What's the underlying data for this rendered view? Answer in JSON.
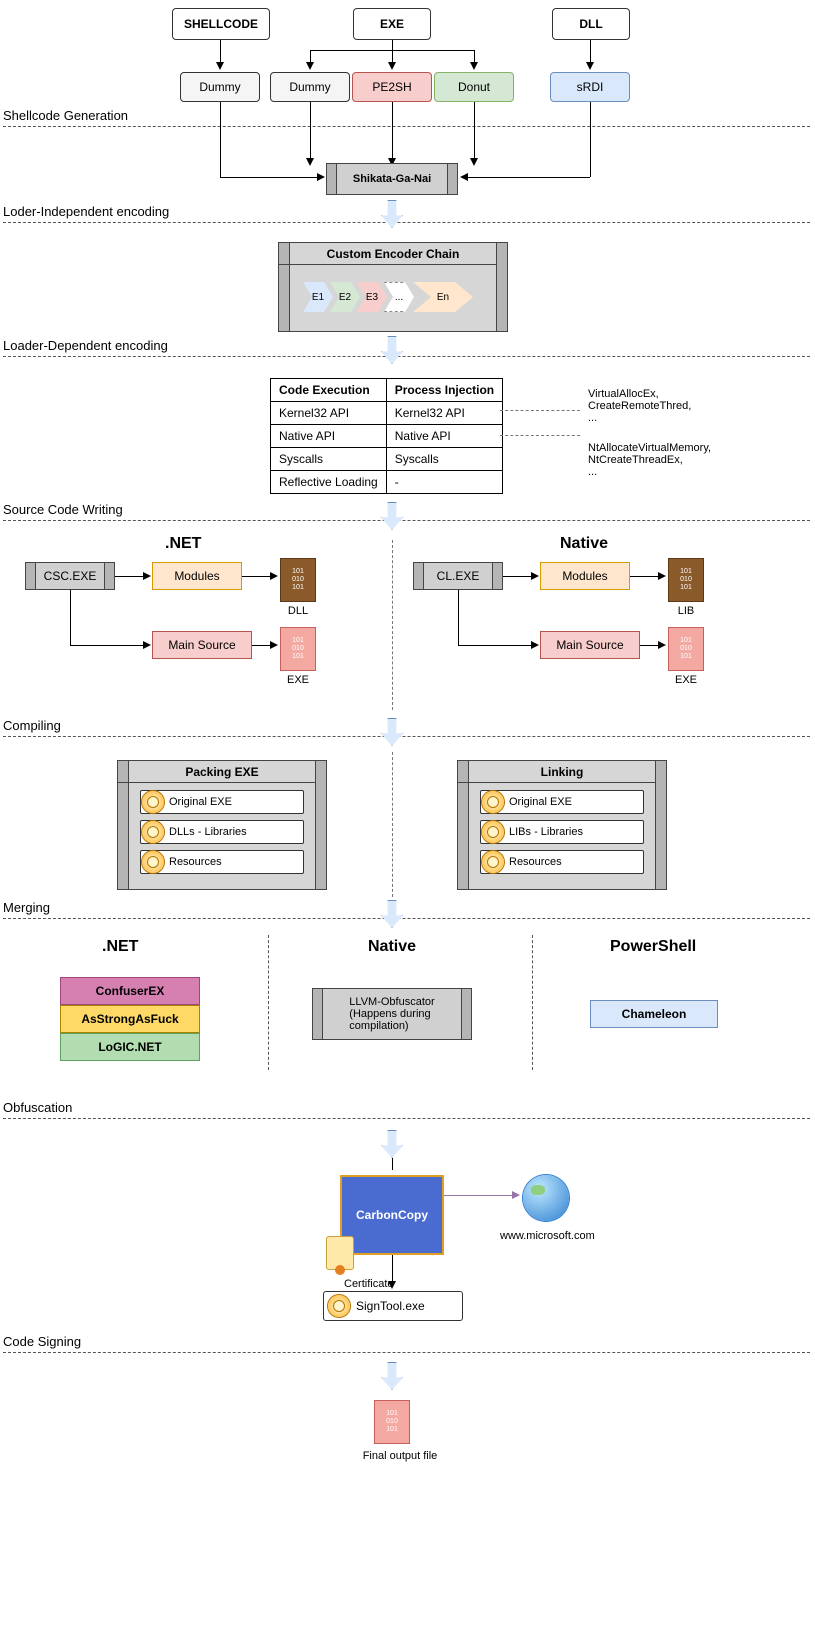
{
  "inputs": {
    "shellcode": "SHELLCODE",
    "exe": "EXE",
    "dll": "DLL"
  },
  "exe_options": {
    "dummy1": "Dummy",
    "dummy2": "Dummy",
    "pe2sh": "PE2SH",
    "donut": "Donut",
    "srdi": "sRDI"
  },
  "sections": {
    "shellcode_gen": "Shellcode Generation",
    "loder_indep": "Loder-Independent encoding",
    "loader_dep": "Loader-Dependent encoding",
    "source_writing": "Source Code Writing",
    "compiling": "Compiling",
    "merging": "Merging",
    "obfuscation": "Obfuscation",
    "code_signing": "Code Signing"
  },
  "shikata": "Shikata-Ga-Nai",
  "encoder_chain": {
    "title": "Custom Encoder Chain",
    "items": [
      "E1",
      "E2",
      "E3",
      "...",
      "En"
    ]
  },
  "tbl": {
    "h1": "Code Execution",
    "h2": "Process Injection",
    "rows": [
      [
        "Kernel32 API",
        "Kernel32 API"
      ],
      [
        "Native API",
        "Native API"
      ],
      [
        "Syscalls",
        "Syscalls"
      ],
      [
        "Reflective Loading",
        "-"
      ]
    ],
    "annot1": "VirtualAllocEx,\nCreateRemoteThred,\n...",
    "annot2": "NtAllocateVirtualMemory,\nNtCreateThreadEx,\n..."
  },
  "compile": {
    "net_title": ".NET",
    "native_title": "Native",
    "csc": "CSC.EXE",
    "cl": "CL.EXE",
    "modules": "Modules",
    "main": "Main Source",
    "dll": "DLL",
    "lib": "LIB",
    "exe": "EXE"
  },
  "packing": {
    "title": "Packing EXE",
    "items": [
      "Original EXE",
      "DLLs - Libraries",
      "Resources"
    ]
  },
  "linking": {
    "title": "Linking",
    "items": [
      "Original EXE",
      "LIBs - Libraries",
      "Resources"
    ]
  },
  "obf": {
    "net": ".NET",
    "native": "Native",
    "ps": "PowerShell",
    "net_items": [
      "ConfuserEX",
      "AsStrongAsFuck",
      "LoGIC.NET"
    ],
    "native_item": "LLVM-Obfuscator\n(Happens during\ncompilation)",
    "ps_item": "Chameleon"
  },
  "sign": {
    "carbon": "CarbonCopy",
    "cert": "Certificate",
    "signtool": "SignTool.exe",
    "url": "www.microsoft.com"
  },
  "final": "Final output file",
  "bin": "101\n010\n101"
}
